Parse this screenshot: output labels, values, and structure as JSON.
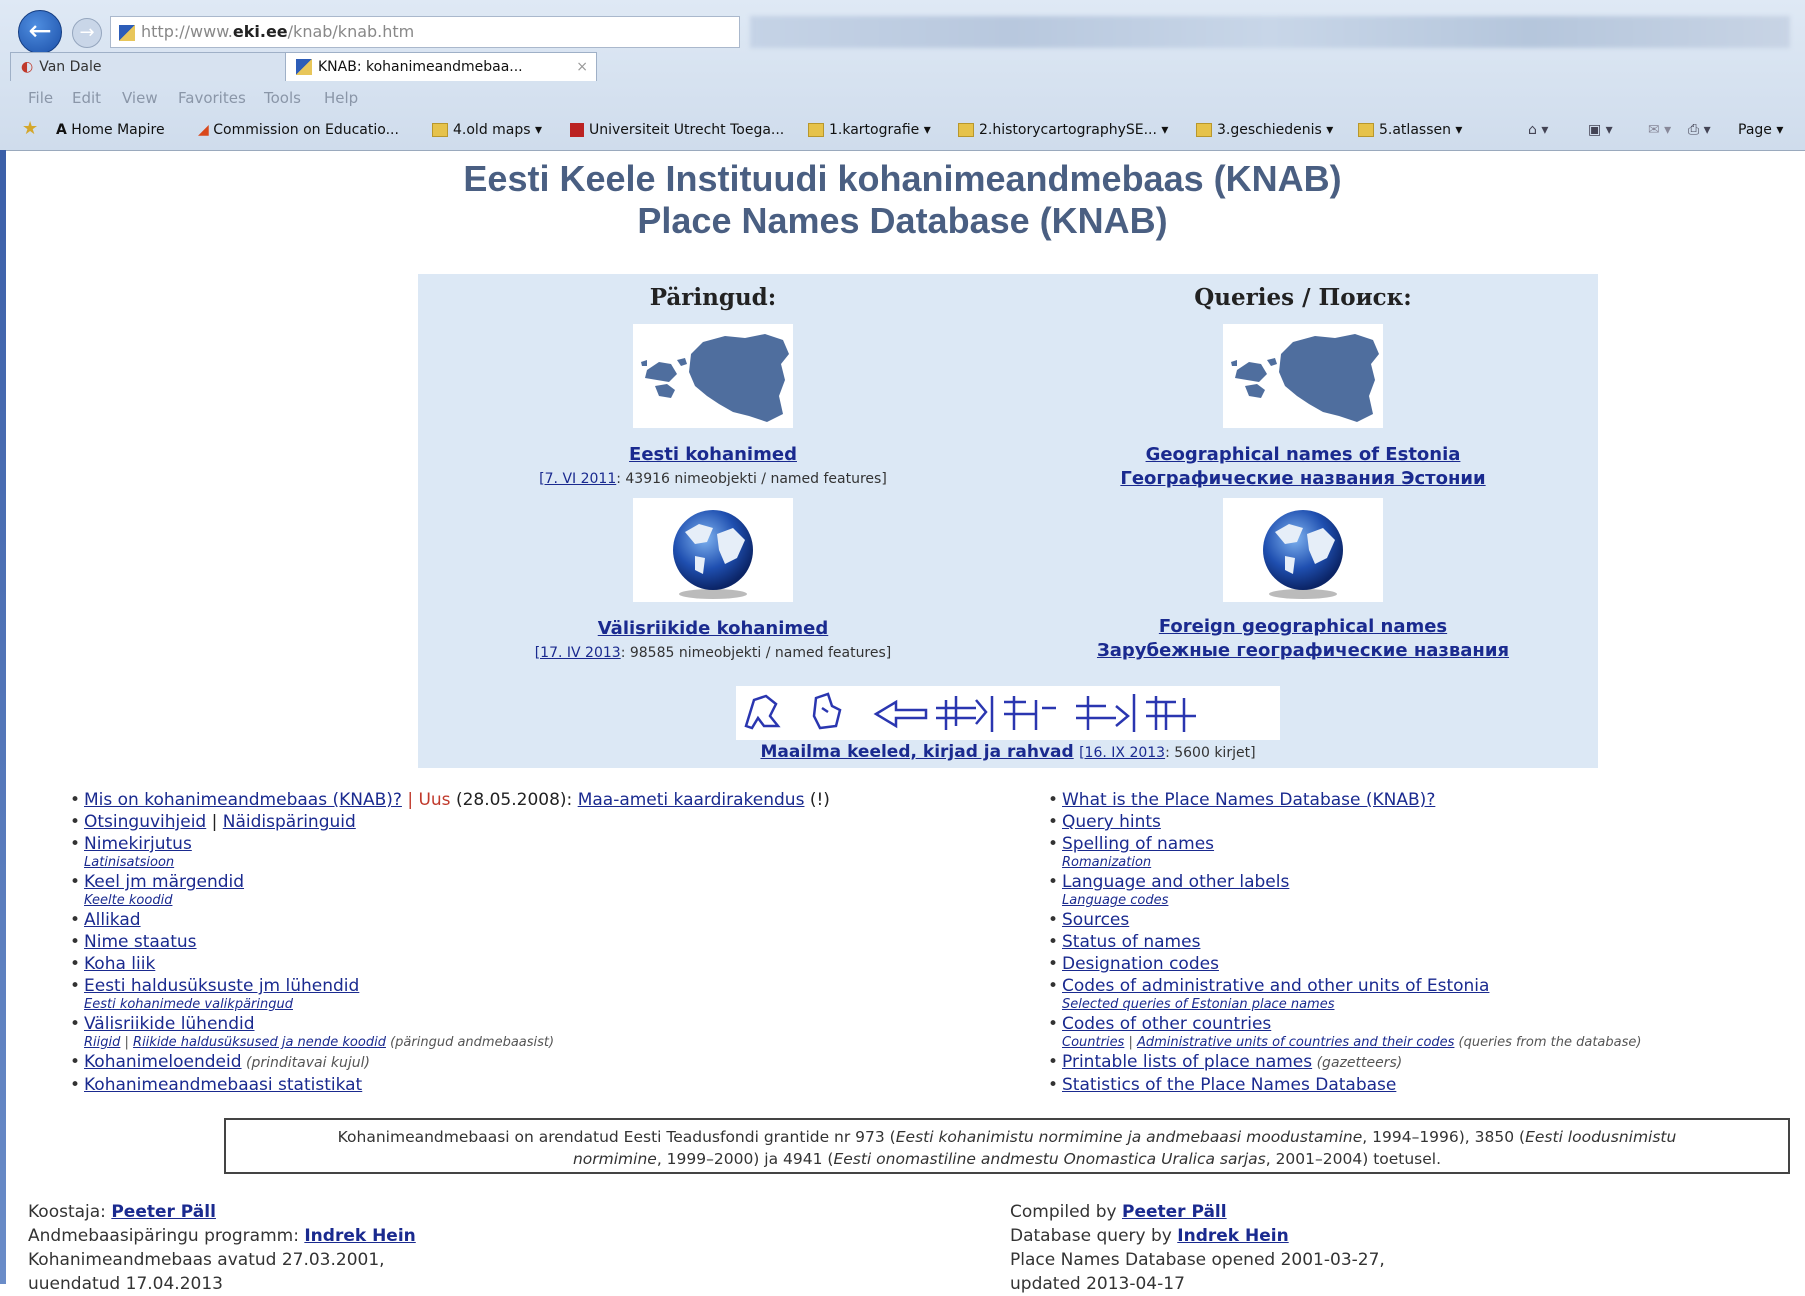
{
  "browser": {
    "url_prefix": "http://www.",
    "url_domain": "eki.ee",
    "url_path": "/knab/knab.htm",
    "tabs": [
      {
        "label": "Van Dale"
      },
      {
        "label": "KNAB: kohanimeandmebaa...",
        "close": "×"
      }
    ],
    "menu": [
      "File",
      "Edit",
      "View",
      "Favorites",
      "Tools",
      "Help"
    ],
    "favorites": [
      "Home Mapire",
      "Commission on Educatio...",
      "4.old maps ▾",
      "Universiteit Utrecht Toega...",
      "1.kartografie ▾",
      "2.historycartographySE... ▾",
      "3.geschiedenis ▾",
      "5.atlassen ▾"
    ],
    "toolbar_right": "Page ▾"
  },
  "page": {
    "title_line1": "Eesti Keele Instituudi kohanimeandmebaas (KNAB)",
    "title_line2": "Place Names Database (KNAB)",
    "left": {
      "heading": "Päringud:",
      "estonia_link": "Eesti kohanimed",
      "estonia_meta_date": "[7. VI 2011",
      "estonia_meta_rest": ": 43916 nimeobjekti / named features]",
      "foreign_link": "Välisriikide kohanimed",
      "foreign_meta_date": "[17. IV 2013",
      "foreign_meta_rest": ": 98585 nimeobjekti / named features]"
    },
    "right": {
      "heading": "Queries / Поиск:",
      "estonia_link": "Geographical names of Estonia",
      "estonia_link_ru": "Географические названия Эстонии",
      "foreign_link": "Foreign geographical names",
      "foreign_link_ru": "Зарубежные географические названия"
    },
    "languages": {
      "link": "Maailma keeled, kirjad ja rahvad",
      "date": "[16. IX 2013",
      "rest": ": 5600 kirjet]"
    },
    "list_left": {
      "what": "Mis on kohanimeandmebaas (KNAB)?",
      "sep": " | ",
      "new_label": "Uus",
      "new_date": " (28.05.2008): ",
      "new_link": "Maa-ameti kaardirakendus",
      "new_suffix": " (!)",
      "guide": "Otsinguvihjeid",
      "guide_sep": " | ",
      "examples": "Näidispäringuid",
      "spelling": "Nimekirjutus",
      "spelling_sub": "Latinisatsioon",
      "language": "Keel jm märgendid",
      "language_sub": "Keelte koodid",
      "sources": "Allikad",
      "status": "Nime staatus",
      "type": "Koha liik",
      "admin": "Eesti haldusüksuste jm lühendid",
      "admin_sub": "Eesti kohanimede valikpäringud",
      "countries": "Välisriikide lühendid",
      "countries_sub1": "Riigid",
      "countries_sub_sep": " | ",
      "countries_sub2": "Riikide haldusüksused ja nende koodid",
      "countries_sub_note": " (päringud andmebaasist)",
      "gazetteers": "Kohanimeloendeid",
      "gazetteers_note": " (prinditavai kujul)",
      "statistics": "Kohanimeandmebaasi statistikat"
    },
    "list_right": {
      "what": "What is the Place Names Database (KNAB)?",
      "hints": "Query hints",
      "spelling": "Spelling of names",
      "spelling_sub": "Romanization",
      "language": "Language and other labels",
      "language_sub": "Language codes",
      "sources": "Sources",
      "status": "Status of names",
      "designation": "Designation codes",
      "admin": "Codes of administrative and other units of Estonia",
      "admin_sub": "Selected queries of Estonian place names",
      "countries": "Codes of other countries",
      "countries_sub1": "Countries",
      "countries_sub_sep": " | ",
      "countries_sub2": "Administrative units of countries and their codes",
      "countries_sub_note": " (queries from the database)",
      "gazetteers": "Printable lists of place names",
      "gazetteers_note": " (gazetteers)",
      "statistics": "Statistics of the Place Names Database"
    },
    "funding": {
      "p1": "Kohanimeandmebaasi on arendatud Eesti Teadusfondi grantide nr 973 (",
      "i1": "Eesti kohanimistu normimine ja andmebaasi moodustamine",
      "p2": ", 1994–1996), 3850 (",
      "i2": "Eesti loodusnimistu",
      "i2b": "normimine",
      "p3": ", 1999–2000) ja 4941 (",
      "i3": "Eesti onomastiline andmestu Onomastica Uralica sarjas",
      "p4": ", 2001–2004) toetusel."
    },
    "footer_left": {
      "compiler_label": "Koostaja: ",
      "compiler": "Peeter Päll",
      "program_label": "Andmebaasipäringu programm: ",
      "program": "Indrek Hein",
      "opened": "Kohanimeandmebaas avatud 27.03.2001,",
      "updated": "uuendatud 17.04.2013"
    },
    "footer_right": {
      "compiler_label": "Compiled by ",
      "compiler": "Peeter Päll",
      "program_label": "Database query by ",
      "program": "Indrek Hein",
      "opened": "Place Names Database opened 2001-03-27,",
      "updated": "updated 2013-04-17"
    }
  },
  "colors": {
    "link": "#1a2a8f",
    "title": "#4a5f82",
    "panel": "#dce8f5",
    "new": "#c0392b",
    "map": "#4f6e9e"
  },
  "icons": [
    "back-icon",
    "forward-icon",
    "favicon-icon",
    "star-icon",
    "folder-icon",
    "estonia-map-icon",
    "globe-icon",
    "script-glyphs-icon",
    "close-icon"
  ]
}
